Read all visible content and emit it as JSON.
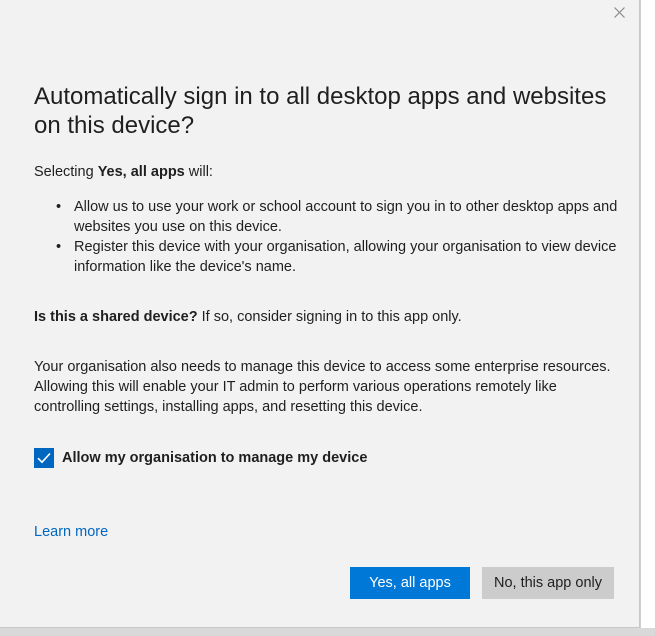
{
  "dialog": {
    "title": "Automatically sign in to all desktop apps and websites on this device?",
    "intro_prefix": "Selecting ",
    "intro_bold": "Yes, all apps",
    "intro_suffix": " will:",
    "bullets": [
      "Allow us to use your work or school account to sign you in to other desktop apps and websites you use on this device.",
      "Register this device with your organisation, allowing your organisation to view device information like the device's name."
    ],
    "shared_bold": "Is this a shared device?",
    "shared_rest": " If so, consider signing in to this app only.",
    "manage_text": "Your organisation also needs to manage this device to access some enterprise resources. Allowing this will enable your IT admin to perform various operations remotely like controlling settings, installing apps, and resetting this device.",
    "checkbox": {
      "label": "Allow my organisation to manage my device",
      "checked": true
    },
    "learn_more": "Learn more",
    "buttons": {
      "primary": "Yes, all apps",
      "secondary": "No, this app only"
    }
  },
  "icons": {
    "close": "close-icon",
    "check": "checkmark-icon"
  },
  "colors": {
    "accent": "#0078d7",
    "link": "#0067c0",
    "checkbox": "#0067c0",
    "secondary_button": "#cccccc",
    "background": "#f2f2f2"
  }
}
